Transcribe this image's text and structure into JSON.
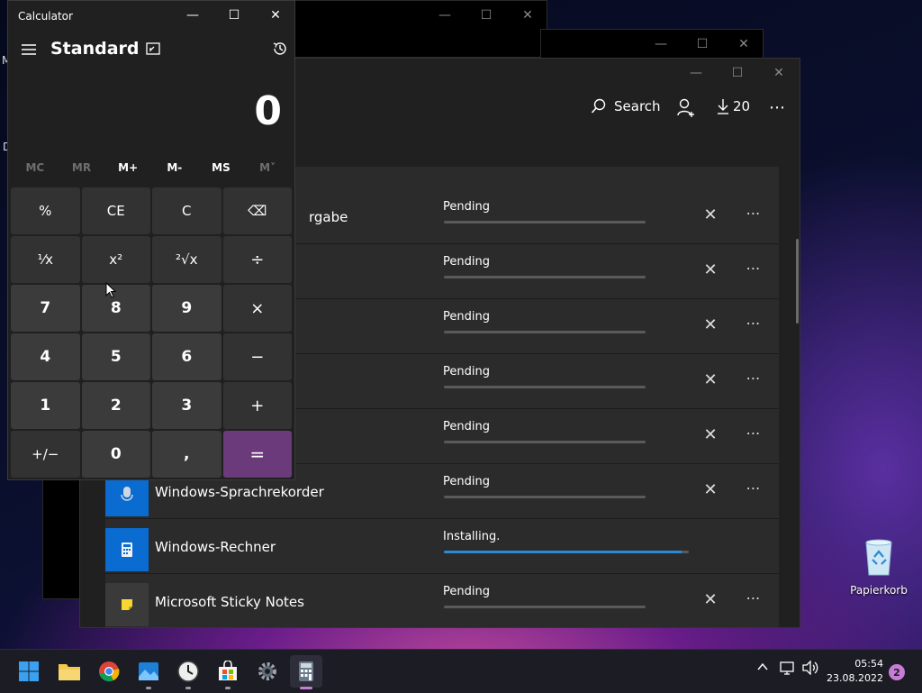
{
  "desktop": {
    "recycle_bin_label": "Papierkorb",
    "edge_letters": [
      "M",
      "D"
    ]
  },
  "back_windows": {
    "controls": [
      "minimize",
      "maximize",
      "close"
    ]
  },
  "store": {
    "toolbar": {
      "search_label": "Search",
      "downloads_count": "20"
    },
    "rows": [
      {
        "name": "rgabe",
        "status": "Pending",
        "progress": 0,
        "icon": "partial",
        "can_cancel": true
      },
      {
        "name": "",
        "status": "Pending",
        "progress": 0,
        "icon": "hidden",
        "can_cancel": true
      },
      {
        "name": "",
        "status": "Pending",
        "progress": 0,
        "icon": "hidden",
        "can_cancel": true
      },
      {
        "name": "",
        "status": "Pending",
        "progress": 0,
        "icon": "hidden",
        "can_cancel": true
      },
      {
        "name": "",
        "status": "Pending",
        "progress": 0,
        "icon": "hidden",
        "can_cancel": true
      },
      {
        "name": "Windows-Sprachrekorder",
        "status": "Pending",
        "progress": 0,
        "icon": "microphone",
        "can_cancel": true
      },
      {
        "name": "Windows-Rechner",
        "status": "Installing.",
        "progress": 0.97,
        "icon": "calculator",
        "can_cancel": false
      },
      {
        "name": "Microsoft Sticky Notes",
        "status": "Pending",
        "progress": 0,
        "icon": "sticky-note",
        "can_cancel": true
      }
    ]
  },
  "calculator": {
    "title": "Calculator",
    "mode": "Standard",
    "display": "0",
    "memory": [
      "MC",
      "MR",
      "M+",
      "M-",
      "MS",
      "M˅"
    ],
    "memory_disabled": [
      true,
      true,
      false,
      false,
      false,
      true
    ],
    "keys": [
      {
        "label": "%",
        "kind": "fn"
      },
      {
        "label": "CE",
        "kind": "fn"
      },
      {
        "label": "C",
        "kind": "fn"
      },
      {
        "label": "⌫",
        "kind": "fn"
      },
      {
        "label": "¹⁄x",
        "kind": "fn"
      },
      {
        "label": "x²",
        "kind": "fn"
      },
      {
        "label": "²√x",
        "kind": "fn"
      },
      {
        "label": "÷",
        "kind": "op"
      },
      {
        "label": "7",
        "kind": "num"
      },
      {
        "label": "8",
        "kind": "num"
      },
      {
        "label": "9",
        "kind": "num"
      },
      {
        "label": "×",
        "kind": "op"
      },
      {
        "label": "4",
        "kind": "num"
      },
      {
        "label": "5",
        "kind": "num"
      },
      {
        "label": "6",
        "kind": "num"
      },
      {
        "label": "−",
        "kind": "op"
      },
      {
        "label": "1",
        "kind": "num"
      },
      {
        "label": "2",
        "kind": "num"
      },
      {
        "label": "3",
        "kind": "num"
      },
      {
        "label": "+",
        "kind": "op"
      },
      {
        "label": "+/−",
        "kind": "fn"
      },
      {
        "label": "0",
        "kind": "num"
      },
      {
        "label": ",",
        "kind": "num"
      },
      {
        "label": "=",
        "kind": "eq"
      }
    ]
  },
  "taskbar": {
    "apps": [
      "start-icon",
      "file-explorer-icon",
      "chrome-icon",
      "photos-icon",
      "clock-app-icon",
      "store-icon",
      "settings-icon",
      "calculator-app-icon"
    ],
    "time": "05:54",
    "date": "23.08.2022",
    "notification_count": "2"
  }
}
